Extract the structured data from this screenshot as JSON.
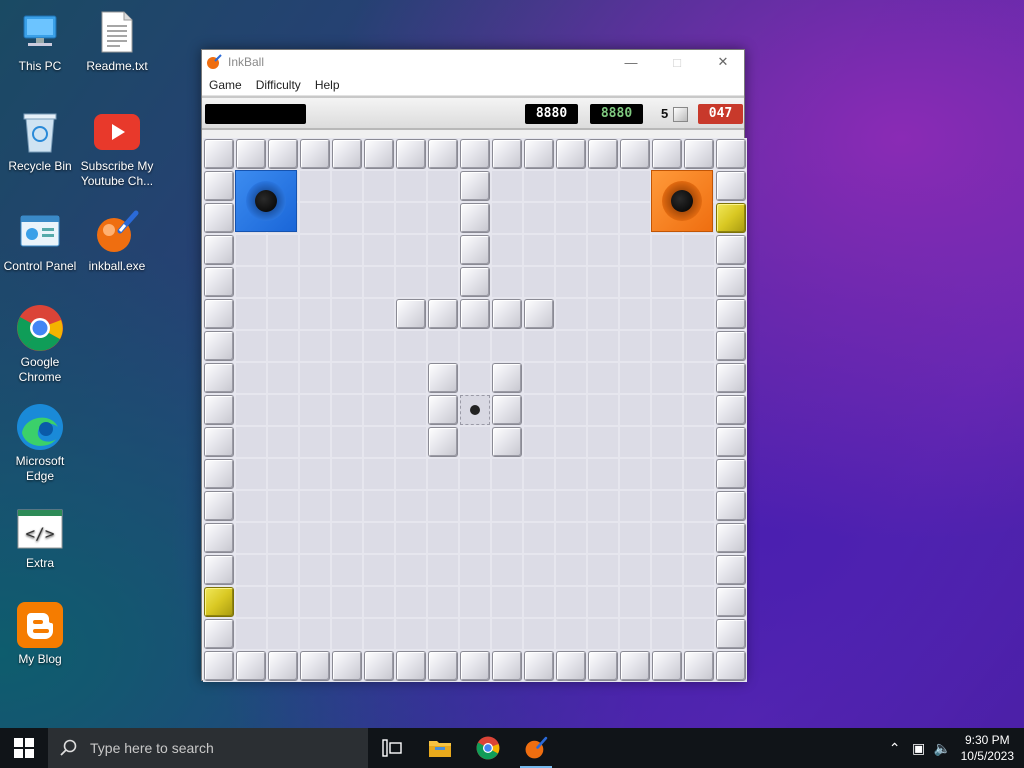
{
  "desktop": {
    "icons": [
      {
        "label": "This PC"
      },
      {
        "label": "Readme.txt"
      },
      {
        "label": "Recycle Bin"
      },
      {
        "label": "Subscribe My Youtube Ch..."
      },
      {
        "label": "Control Panel"
      },
      {
        "label": "inkball.exe"
      },
      {
        "label": "Google Chrome"
      },
      {
        "label": "Microsoft Edge"
      },
      {
        "label": "Extra"
      },
      {
        "label": "My Blog"
      }
    ]
  },
  "window": {
    "title": "InkBall",
    "menu": [
      "Game",
      "Difficulty",
      "Help"
    ],
    "score": {
      "display1": "8880",
      "display2": "8880",
      "ink_count": "5",
      "timer": "047"
    }
  },
  "taskbar": {
    "search_placeholder": "Type here to search",
    "time": "9:30 PM",
    "date": "10/5/2023"
  },
  "colors": {
    "blue_hole": "#1a66d8",
    "orange_hole": "#ef6e10",
    "yellow_block": "#d9c823",
    "timer_bg": "#c8392b",
    "green_digits": "#7fc97f"
  }
}
